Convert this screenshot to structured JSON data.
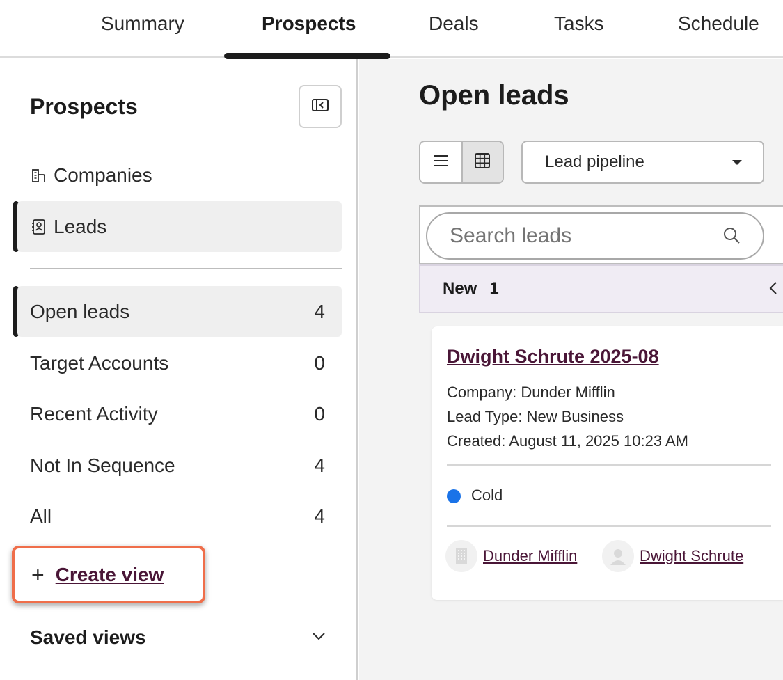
{
  "tabs": [
    {
      "label": "Summary",
      "active": false
    },
    {
      "label": "Prospects",
      "active": true
    },
    {
      "label": "Deals",
      "active": false
    },
    {
      "label": "Tasks",
      "active": false
    },
    {
      "label": "Schedule",
      "active": false
    }
  ],
  "sidebar": {
    "title": "Prospects",
    "collapse_icon": "sidebar-collapse-icon",
    "objects": [
      {
        "label": "Companies",
        "icon": "building-icon",
        "active": false
      },
      {
        "label": "Leads",
        "icon": "contact-card-icon",
        "active": true
      }
    ],
    "views": [
      {
        "label": "Open leads",
        "count": "4",
        "active": true
      },
      {
        "label": "Target Accounts",
        "count": "0",
        "active": false
      },
      {
        "label": "Recent Activity",
        "count": "0",
        "active": false
      },
      {
        "label": "Not In Sequence",
        "count": "4",
        "active": false
      },
      {
        "label": "All",
        "count": "4",
        "active": false
      }
    ],
    "create_view": {
      "label": "Create view",
      "icon": "plus-icon",
      "highlight_color": "#ef6e4a"
    },
    "saved_views": {
      "label": "Saved views",
      "icon": "chevron-down-icon"
    }
  },
  "main": {
    "title": "Open leads",
    "view_toggle": {
      "options": [
        "list",
        "board"
      ],
      "selected": "board"
    },
    "pipeline_select": {
      "value": "Lead pipeline"
    },
    "search": {
      "placeholder": "Search leads"
    },
    "column": {
      "name": "New",
      "count": "1"
    },
    "card": {
      "title": "Dwight Schrute 2025-08",
      "company_line": "Company: Dunder Mifflin",
      "lead_type_line": "Lead Type: New Business",
      "created_line": "Created: August 11, 2025 10:23 AM",
      "status": {
        "label": "Cold",
        "color": "#1a73e8"
      },
      "associations": [
        {
          "label": "Dunder Mifflin",
          "icon": "company-avatar-icon"
        },
        {
          "label": "Dwight Schrute",
          "icon": "contact-avatar-icon"
        }
      ]
    }
  },
  "colors": {
    "accent_dark": "#1c1c1c",
    "link": "#4a1637",
    "highlight": "#ef6e4a",
    "panel_bg": "#f3f3f3"
  }
}
